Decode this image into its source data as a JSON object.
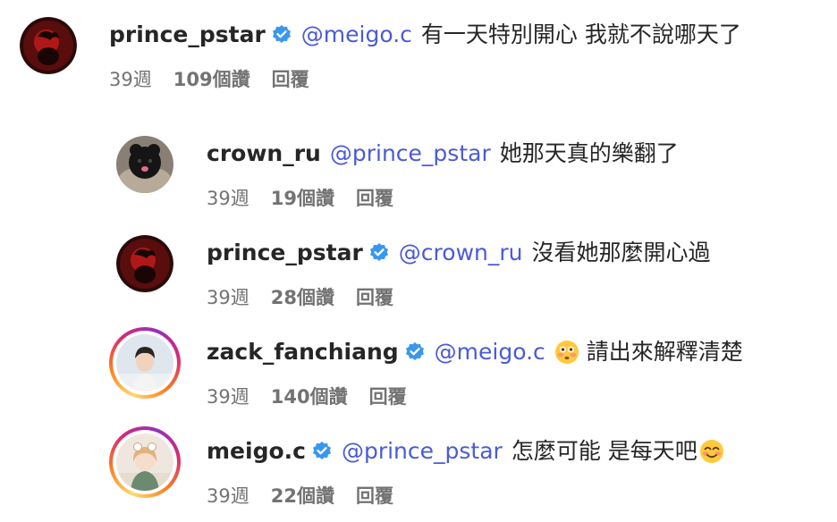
{
  "comments": [
    {
      "username": "prince_pstar",
      "verified": true,
      "mention": "@meigo.c",
      "text": "有一天特別開心 我就不說哪天了",
      "emoji": "",
      "time": "39週",
      "likes": "109個讚",
      "reply": "回覆",
      "avatar": "red-dark"
    },
    {
      "username": "crown_ru",
      "verified": false,
      "mention": "@prince_pstar",
      "text": "她那天真的樂翻了",
      "emoji": "",
      "time": "39週",
      "likes": "19個讚",
      "reply": "回覆",
      "avatar": "dog"
    },
    {
      "username": "prince_pstar",
      "verified": true,
      "mention": "@crown_ru",
      "text": "沒看她那麼開心過",
      "emoji": "",
      "time": "39週",
      "likes": "28個讚",
      "reply": "回覆",
      "avatar": "red-dark"
    },
    {
      "username": "zack_fanchiang",
      "verified": true,
      "mention": "@meigo.c",
      "text": "請出來解釋清楚",
      "emoji": "flushed-face",
      "time": "39週",
      "likes": "140個讚",
      "reply": "回覆",
      "avatar": "person-story"
    },
    {
      "username": "meigo.c",
      "verified": true,
      "mention": "@prince_pstar",
      "text": "怎麼可能 是每天吧",
      "emoji": "smiling-face-blush",
      "time": "39週",
      "likes": "22個讚",
      "reply": "回覆",
      "avatar": "girl-story"
    }
  ],
  "colors": {
    "verified": "#3897f0",
    "mention": "#4a5bd6",
    "meta": "#737373"
  }
}
